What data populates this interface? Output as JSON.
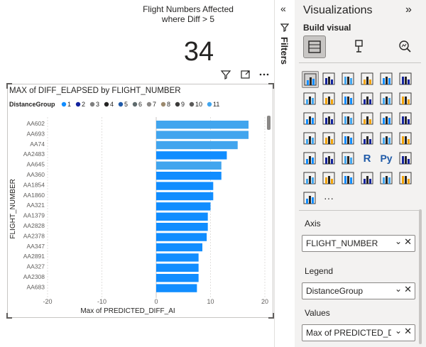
{
  "card": {
    "title_line1": "Flight Numbers Affected",
    "title_line2": "where Diff > 5",
    "value": "34"
  },
  "icons": {
    "filter": "filter-icon",
    "focus": "focus-mode-icon",
    "more": "more-options-icon"
  },
  "chart_data": {
    "type": "bar",
    "orientation": "horizontal",
    "title": "MAX of DIFF_ELAPSED by FLIGHT_NUMBER",
    "legend_title": "DistanceGroup",
    "legend": [
      {
        "label": "1",
        "color": "#118DFF"
      },
      {
        "label": "2",
        "color": "#12239E"
      },
      {
        "label": "3",
        "color": "#7F7F7F"
      },
      {
        "label": "4",
        "color": "#252423"
      },
      {
        "label": "5",
        "color": "#1F5AA8"
      },
      {
        "label": "6",
        "color": "#5F6B6D"
      },
      {
        "label": "7",
        "color": "#8A8886"
      },
      {
        "label": "8",
        "color": "#9C8A6E"
      },
      {
        "label": "9",
        "color": "#3B3A39"
      },
      {
        "label": "10",
        "color": "#5B5A59"
      },
      {
        "label": "11",
        "color": "#41A5EE"
      }
    ],
    "categories": [
      "AA602",
      "AA693",
      "AA74",
      "AA2483",
      "AA645",
      "AA360",
      "AA1854",
      "AA1860",
      "AA321",
      "AA1379",
      "AA2828",
      "AA2378",
      "AA347",
      "AA2891",
      "AA327",
      "AA2308",
      "AA683"
    ],
    "values": [
      17,
      17,
      15,
      13,
      12,
      12,
      10.5,
      10.5,
      10,
      9.5,
      9.5,
      9.3,
      8.5,
      7.8,
      7.8,
      7.8,
      7.5
    ],
    "bar_colors": [
      "#41A5EE",
      "#41A5EE",
      "#41A5EE",
      "#118DFF",
      "#41A5EE",
      "#118DFF",
      "#118DFF",
      "#118DFF",
      "#118DFF",
      "#118DFF",
      "#118DFF",
      "#118DFF",
      "#118DFF",
      "#118DFF",
      "#118DFF",
      "#118DFF",
      "#118DFF"
    ],
    "xlabel": "Max of PREDICTED_DIFF_AI",
    "ylabel": "FLIGHT_NUMBER",
    "xlim": [
      -20,
      20
    ],
    "xticks": [
      -20,
      -10,
      0,
      10,
      20
    ],
    "grid": true
  },
  "filters_pane": {
    "label": "Filters"
  },
  "viz_pane": {
    "title": "Visualizations",
    "build_label": "Build visual",
    "fields": [
      {
        "label": "Axis",
        "value": "FLIGHT_NUMBER"
      },
      {
        "label": "Legend",
        "value": "DistanceGroup"
      },
      {
        "label": "Values",
        "value": "Max of PREDICTED_DI..."
      }
    ],
    "visual_types": [
      "stacked-bar-chart-icon",
      "stacked-column-chart-icon",
      "clustered-bar-chart-icon",
      "clustered-column-chart-icon",
      "100pct-bar-chart-icon",
      "100pct-column-chart-icon",
      "line-chart-icon",
      "area-chart-icon",
      "stacked-area-chart-icon",
      "line-column-chart-icon",
      "line-clustered-column-icon",
      "ribbon-chart-icon",
      "waterfall-chart-icon",
      "funnel-chart-icon",
      "scatter-chart-icon",
      "pie-chart-icon",
      "donut-chart-icon",
      "treemap-icon",
      "map-icon",
      "filled-map-icon",
      "gauge-icon",
      "card-icon",
      "multirow-card-icon",
      "kpi-icon",
      "slicer-icon",
      "table-icon",
      "matrix-icon",
      "r-visual-icon",
      "python-visual-icon",
      "key-influencers-icon",
      "decomposition-tree-icon",
      "qa-icon",
      "smart-narrative-icon",
      "paginated-report-icon",
      "power-apps-icon",
      "diamond-visual-icon",
      "power-automate-icon",
      "more-visuals-icon"
    ]
  }
}
